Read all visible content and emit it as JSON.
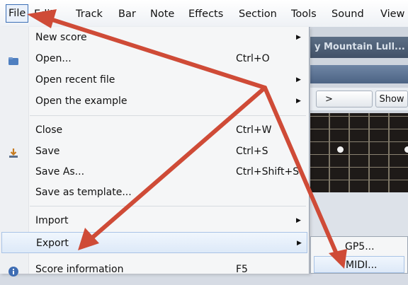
{
  "menubar": {
    "items": [
      "File",
      "Edit",
      "Track",
      "Bar",
      "Note",
      "Effects",
      "Section",
      "Tools",
      "Sound",
      "View"
    ]
  },
  "background": {
    "score_title": "y Mountain Lull...",
    "nav_button": ">",
    "show_button": "Show"
  },
  "file_menu": {
    "new_score": "New score",
    "open": "Open...",
    "open_shortcut": "Ctrl+O",
    "open_recent": "Open recent file",
    "open_example": "Open the example",
    "close": "Close",
    "close_shortcut": "Ctrl+W",
    "save": "Save",
    "save_shortcut": "Ctrl+S",
    "save_as": "Save As...",
    "save_as_shortcut": "Ctrl+Shift+S",
    "save_template": "Save as template...",
    "import": "Import",
    "export": "Export",
    "score_info": "Score information",
    "score_info_shortcut": "F5"
  },
  "export_submenu": {
    "gp5": "GP5...",
    "midi": "MIDI..."
  },
  "colors": {
    "annotation_arrow": "#cf4b37",
    "menu_highlight": "#dde9f8",
    "menu_highlight_border": "#a9c3e6"
  }
}
